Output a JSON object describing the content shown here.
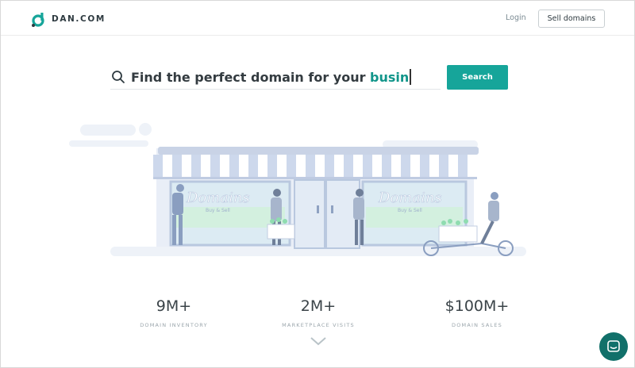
{
  "header": {
    "brand": "DAN.COM",
    "login_label": "Login",
    "sell_label": "Sell domains"
  },
  "search": {
    "prefix": "Find the perfect domain for your ",
    "typed": "busin",
    "button_label": "Search"
  },
  "illustration": {
    "sign_left": "Domains",
    "sign_left_sub": "Buy & Sell",
    "sign_right": "Domains",
    "sign_right_sub": "Buy & Sell"
  },
  "stats": [
    {
      "value": "9M+",
      "label": "DOMAIN INVENTORY"
    },
    {
      "value": "2M+",
      "label": "MARKETPLACE VISITS"
    },
    {
      "value": "$100M+",
      "label": "DOMAIN SALES"
    }
  ],
  "colors": {
    "accent": "#16a59a",
    "typed": "#11958a",
    "chat": "#11706a"
  },
  "icons": {
    "search": "search-icon",
    "chevron": "chevron-down-icon",
    "chat": "chat-icon"
  }
}
